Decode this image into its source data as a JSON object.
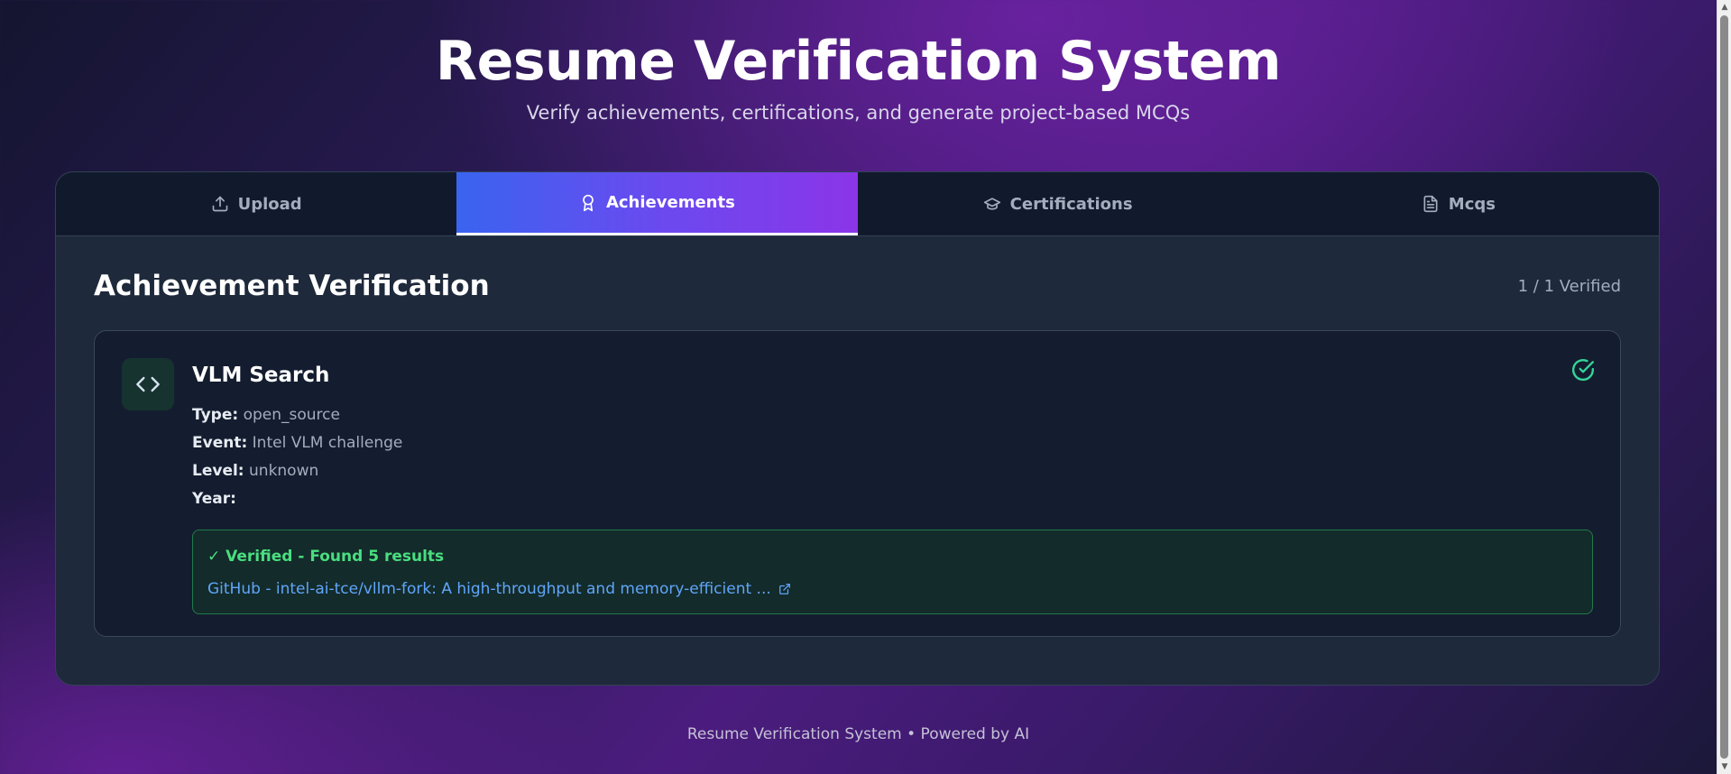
{
  "header": {
    "title": "Resume Verification System",
    "subtitle": "Verify achievements, certifications, and generate project-based MCQs"
  },
  "tabs": [
    {
      "label": "Upload",
      "icon": "upload-icon",
      "active": false
    },
    {
      "label": "Achievements",
      "icon": "award-icon",
      "active": true
    },
    {
      "label": "Certifications",
      "icon": "graduation-cap-icon",
      "active": false
    },
    {
      "label": "Mcqs",
      "icon": "document-icon",
      "active": false
    }
  ],
  "section": {
    "title": "Achievement Verification",
    "verified_count": "1 / 1 Verified"
  },
  "achievement": {
    "icon": "code-icon",
    "title": "VLM Search",
    "meta": [
      {
        "key": "Type:",
        "value": "open_source"
      },
      {
        "key": "Event:",
        "value": "Intel VLM challenge"
      },
      {
        "key": "Level:",
        "value": "unknown"
      },
      {
        "key": "Year:",
        "value": ""
      }
    ],
    "status_icon": "check-circle-icon",
    "verification": {
      "status": "✓ Verified - Found 5 results",
      "link_text": "GitHub - intel-ai-tce/vllm-fork: A high-throughput and memory-efficient ...",
      "link_icon": "external-link-icon"
    }
  },
  "footer": {
    "text": "Resume Verification System • Powered by AI"
  },
  "colors": {
    "accent_gradient_start": "#3a64f0",
    "accent_gradient_end": "#8b35e8",
    "success": "#4ade80",
    "link": "#60a5fa",
    "card_bg": "#1e293b"
  }
}
